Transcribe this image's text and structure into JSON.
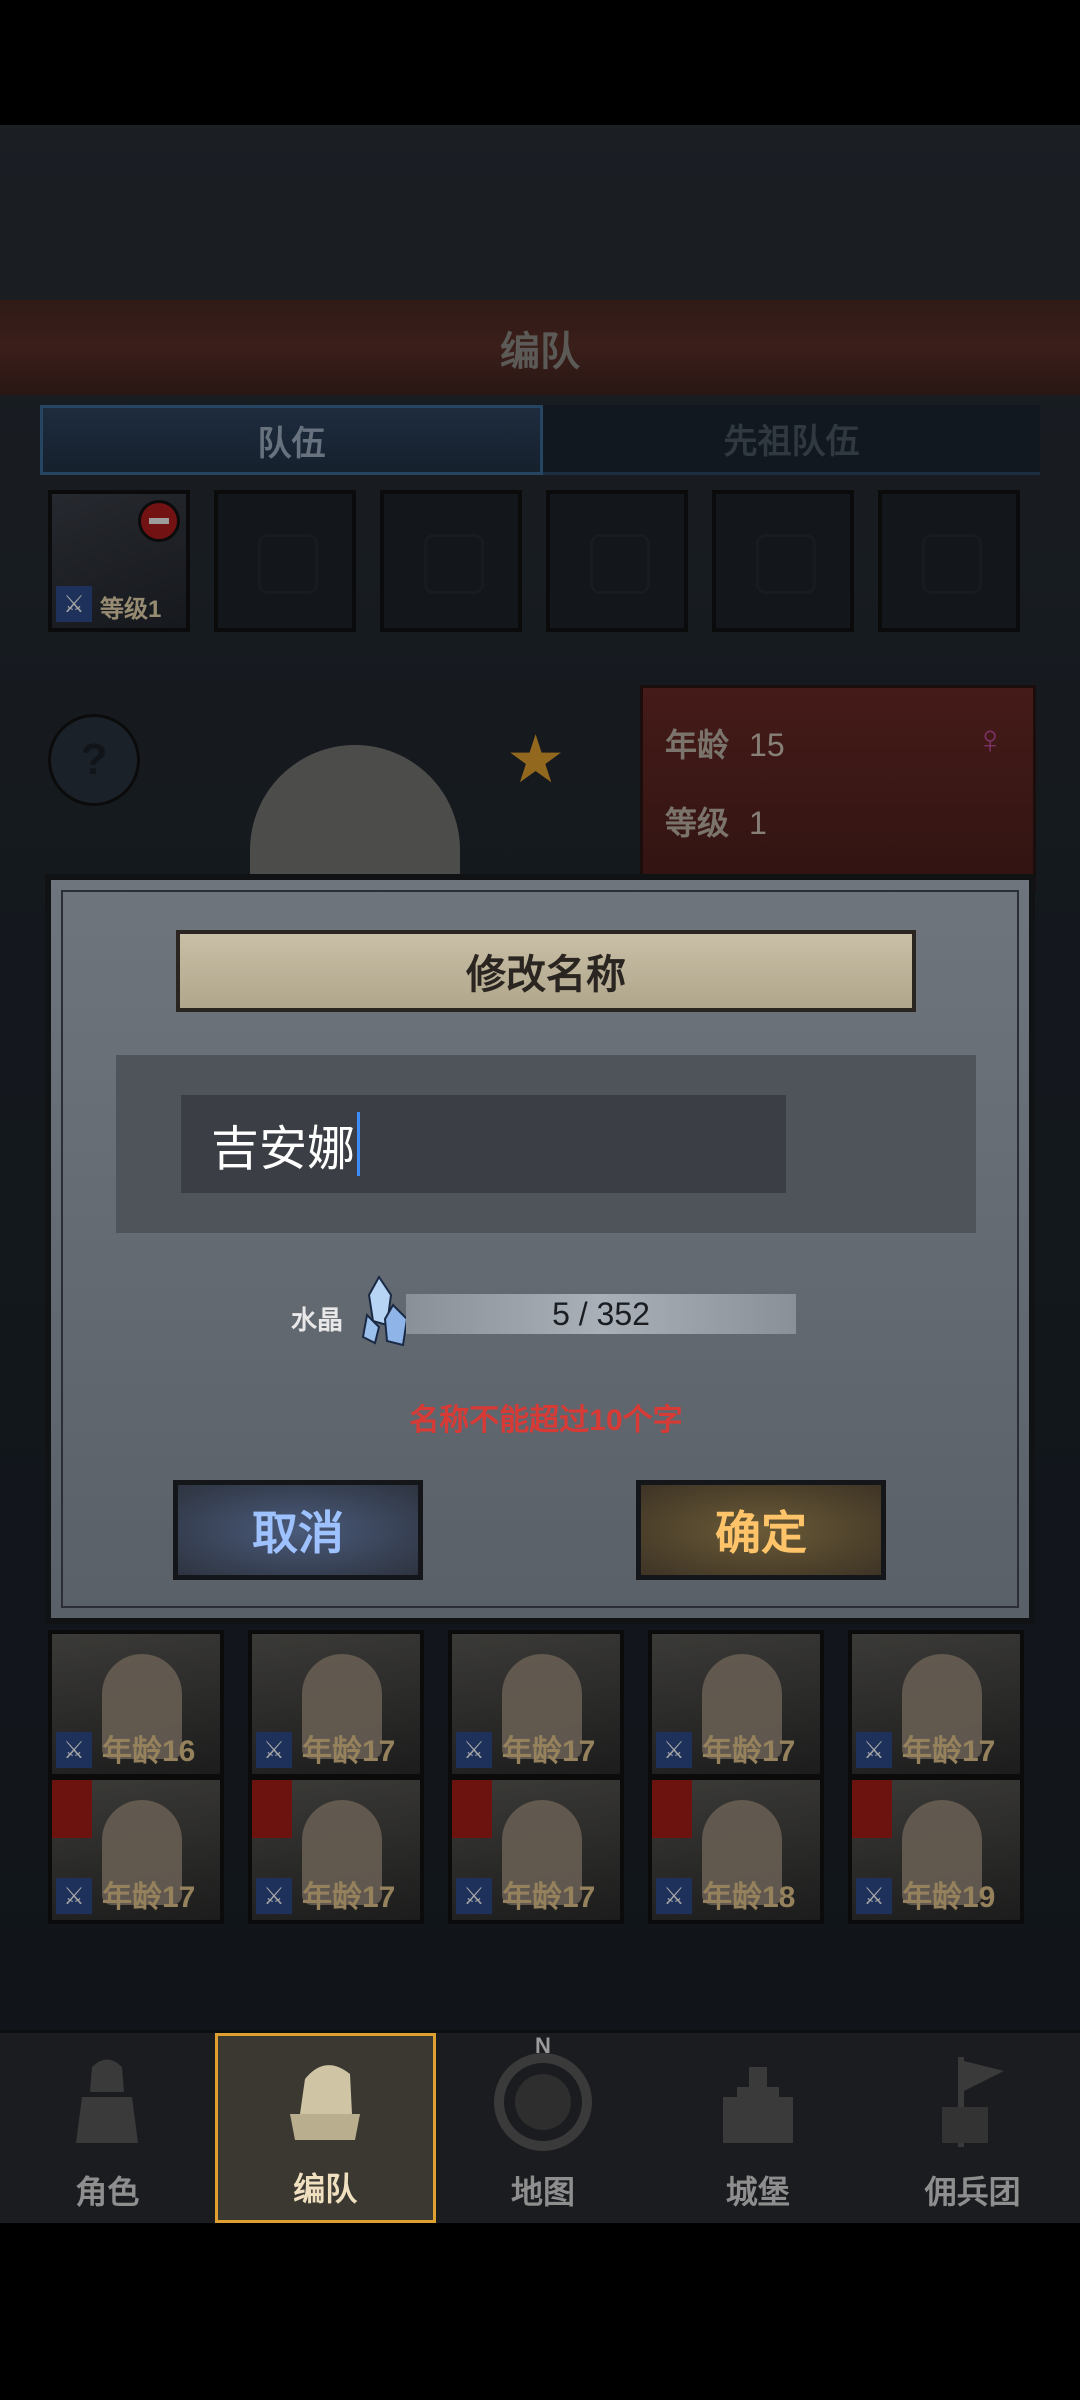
{
  "header": {
    "title": "编队"
  },
  "tabs": [
    {
      "label": "队伍"
    },
    {
      "label": "先祖队伍"
    }
  ],
  "team_slots": {
    "filled_level": "等级1"
  },
  "character": {
    "age_label": "年龄",
    "age_value": "15",
    "level_label": "等级",
    "level_value": "1"
  },
  "roster": {
    "row1": [
      "年龄16",
      "年龄17",
      "年龄17",
      "年龄17",
      "年龄17"
    ],
    "row2": [
      "年龄17",
      "年龄17",
      "年龄17",
      "年龄18",
      "年龄19"
    ]
  },
  "dialog": {
    "title": "修改名称",
    "input_value": "吉安娜",
    "cost_label": "水晶",
    "cost_value": "5 / 352",
    "warning": "名称不能超过10个字",
    "cancel_label": "取消",
    "confirm_label": "确定"
  },
  "nav": [
    {
      "label": "角色",
      "icon": "knight-icon"
    },
    {
      "label": "编队",
      "icon": "formation-helmet-icon"
    },
    {
      "label": "地图",
      "icon": "compass-map-icon"
    },
    {
      "label": "城堡",
      "icon": "castle-icon"
    },
    {
      "label": "佣兵团",
      "icon": "mercenary-flag-icon"
    }
  ],
  "colors": {
    "accent_gold": "#e0a030",
    "warning_red": "#d83a36",
    "tab_blue": "#3a6b99"
  }
}
